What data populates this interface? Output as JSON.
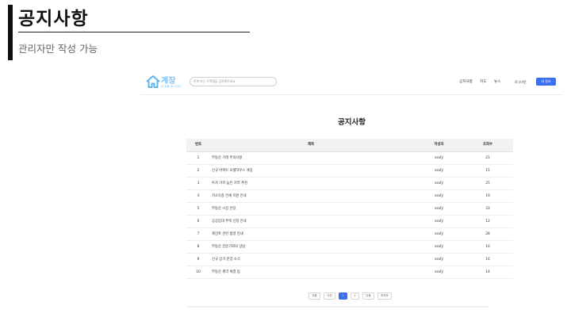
{
  "slide": {
    "title": "공지사항",
    "subtitle": "관리자만 작성 가능"
  },
  "app": {
    "logo_text": "계장",
    "logo_sub": "내 집을 꿈 이야기",
    "search_placeholder": "주제 또는 주택명을 입력해주세요.",
    "nav": [
      "공지사항",
      "지도",
      "뉴스"
    ],
    "login_label": "로그아웃",
    "mypage_label": "내 정보",
    "accent_color": "#3b6ef0"
  },
  "notice": {
    "page_title": "공지사항",
    "columns": [
      "번호",
      "제목",
      "작성자",
      "조회수"
    ],
    "rows": [
      {
        "no": "1",
        "title": "부동산 거래 주의사항",
        "author": "ssafy",
        "views": "21"
      },
      {
        "no": "2",
        "title": "신규 아파트 모델하우스 개장",
        "author": "ssafy",
        "views": "15"
      },
      {
        "no": "3",
        "title": "투자 가치 높은 지역 추천",
        "author": "ssafy",
        "views": "25"
      },
      {
        "no": "4",
        "title": "저소득층 전세 지원 안내",
        "author": "ssafy",
        "views": "19"
      },
      {
        "no": "5",
        "title": "부동산 시장 전망",
        "author": "ssafy",
        "views": "33"
      },
      {
        "no": "6",
        "title": "공공임대 주택 신청 안내",
        "author": "ssafy",
        "views": "12"
      },
      {
        "no": "7",
        "title": "재건축 관련 법령 안내",
        "author": "ssafy",
        "views": "28"
      },
      {
        "no": "8",
        "title": "부동산 전문가와의 상담",
        "author": "ssafy",
        "views": "10"
      },
      {
        "no": "9",
        "title": "신규 상가 분양 소식",
        "author": "ssafy",
        "views": "16"
      },
      {
        "no": "10",
        "title": "부동산 계약 체결 팁",
        "author": "ssafy",
        "views": "14"
      }
    ],
    "pagination": {
      "first_label": "처음",
      "prev_label": "이전",
      "pages": [
        "1",
        "2"
      ],
      "current_page": "1",
      "next_label": "다음",
      "last_label": "마지막"
    }
  }
}
